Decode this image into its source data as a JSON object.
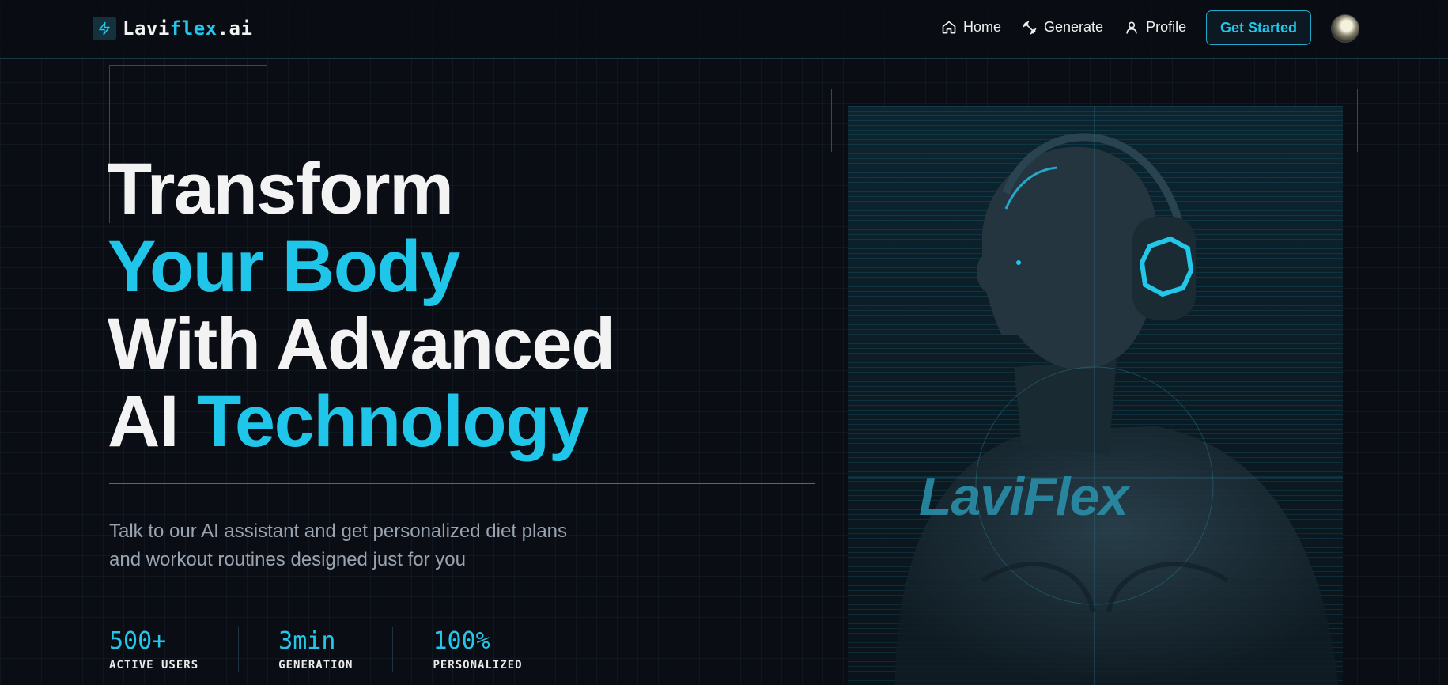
{
  "nav": {
    "logo_prefix": "Lavi",
    "logo_accent": "flex",
    "logo_suffix": ".ai",
    "links": [
      {
        "label": "Home",
        "icon": "home-icon"
      },
      {
        "label": "Generate",
        "icon": "dumbbell-icon"
      },
      {
        "label": "Profile",
        "icon": "user-icon"
      }
    ],
    "cta_label": "Get Started"
  },
  "hero": {
    "line1": "Transform",
    "line2": "Your Body",
    "line3": "With Advanced",
    "line4_white": "AI",
    "line4_cyan": "Technology",
    "subtitle": "Talk to our AI assistant and get personalized diet plans and workout routines designed just for you",
    "stats": [
      {
        "value": "500+",
        "label": "ACTIVE USERS"
      },
      {
        "value": "3min",
        "label": "GENERATION"
      },
      {
        "value": "100%",
        "label": "PERSONALIZED"
      }
    ],
    "image_wordmark": "LaviFlex"
  },
  "colors": {
    "accent": "#1fc6ea",
    "background": "#0a0d14",
    "text": "#f3f3f3",
    "muted": "#9aa4b0"
  }
}
